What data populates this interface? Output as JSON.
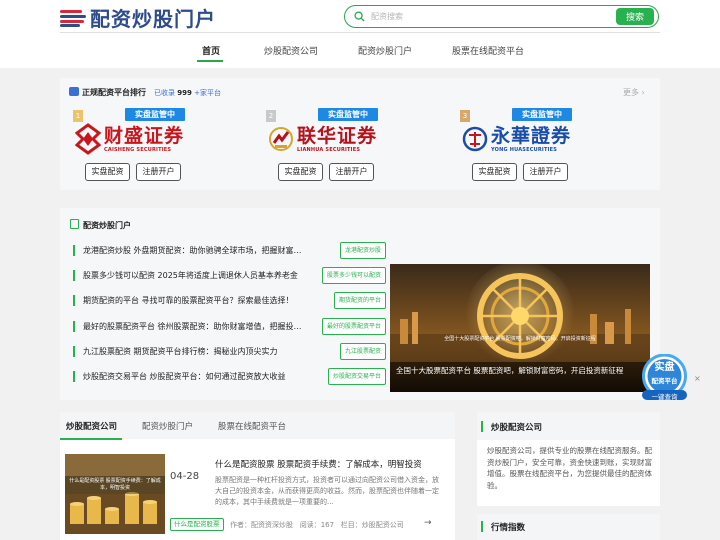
{
  "header": {
    "logo_text": "配资炒股门户",
    "search_placeholder": "配资搜索",
    "search_button": "搜索"
  },
  "nav": {
    "items": [
      {
        "label": "首页",
        "active": true
      },
      {
        "label": "炒股配资公司"
      },
      {
        "label": "配资炒股门户"
      },
      {
        "label": "股票在线配资平台"
      }
    ]
  },
  "ranking": {
    "title": "正规配资平台排行",
    "sub_prefix": "已收录",
    "sub_count": "999",
    "sub_suffix": "+家平台",
    "more": "更多",
    "cards": [
      {
        "rank": "1",
        "tag": "实盘监管中",
        "name": "财盛证券",
        "en": "CAISHENG SECURITIES",
        "color": "#c8161d",
        "btn1": "实盘配资",
        "btn2": "注册开户"
      },
      {
        "rank": "2",
        "tag": "实盘监管中",
        "name": "联华证券",
        "en": "LIANHUA SECURITIES",
        "color": "#b5121b",
        "btn1": "实盘配资",
        "btn2": "注册开户"
      },
      {
        "rank": "3",
        "tag": "实盘监管中",
        "name": "永華證券",
        "en": "YONG HUASECURITIES",
        "color": "#1a4da8",
        "btn1": "实盘配资",
        "btn2": "注册开户"
      }
    ]
  },
  "news": {
    "title": "配资炒股门户",
    "items": [
      {
        "text": "龙港配资炒股 外盘期货配资：助你驰骋全球市场，把握财富先机",
        "tag": "龙港配资炒股"
      },
      {
        "text": "股票多少钱可以配资 2025年将适度上调退休人员基本养老金",
        "tag": "股票多少钱可以配资"
      },
      {
        "text": "期货配资的平台 寻找可靠的股票配资平台？探索最佳选择！",
        "tag": "期货配资的平台"
      },
      {
        "text": "最好的股票配资平台 徐州股票配资：助你财富增值，把握投资先机",
        "tag": "最好的股票配资平台"
      },
      {
        "text": "九江股票配资 期货配资平台排行榜：揭秘业内顶尖实力",
        "tag": "九江股票配资"
      },
      {
        "text": "炒股配资交易平台 炒股配资平台：如何通过配资放大收益",
        "tag": "炒股配资交易平台"
      }
    ],
    "banner_caption": "全国十大股票配资平台 股票配资吧，解锁财富密码，开启投资新征程",
    "banner_overlay": "全国十大股票配资平台 股票配资吧，解锁财富密码，开启投资新征程",
    "float_line1": "实盘",
    "float_line2": "配资平台",
    "float_line3": "一键查询",
    "float_close": "×"
  },
  "list": {
    "tabs": [
      {
        "label": "炒股配资公司",
        "active": true
      },
      {
        "label": "配资炒股门户"
      },
      {
        "label": "股票在线配资平台"
      }
    ],
    "article": {
      "date": "04-28",
      "tag": "什么是配资股票",
      "thumb_text": "什么是配资股票 股票配资手续费：了解成本，明智投资",
      "title": "什么是配资股票 股票配资手续费：了解成本，明智投资",
      "desc": "股票配资是一种杠杆投资方式，投资者可以通过向配资公司借入资金，放大自己的投资本金，从而获得更高的收益。然而，股票配资也伴随着一定的成本，其中手续费就是一项重要的...",
      "author_label": "作者：",
      "author": "配资资深炒股",
      "views_label": "阅读：",
      "views": "167",
      "column_label": "栏目：",
      "column": "炒股配资公司"
    }
  },
  "about": {
    "title": "炒股配资公司",
    "body": "炒股配资公司，提供专业的股票在线配资服务。配资炒股门户，安全可靠，资金快速到账，实现财富增值。股票在线配资平台，为您提供最佳的配资体验。"
  },
  "index_box": {
    "title": "行情指数"
  }
}
